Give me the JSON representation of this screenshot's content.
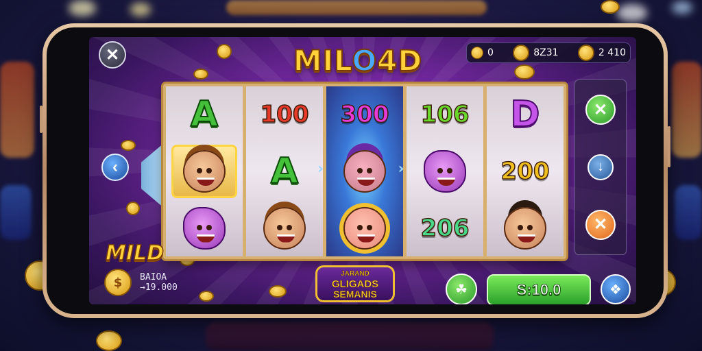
{
  "app": {
    "logo_prefix": "MIL",
    "logo_o": "O",
    "logo_suffix": "4D"
  },
  "topbar": {
    "coins_value": "0",
    "bonus_value": "8Z31",
    "balance_value": "2 410"
  },
  "reels": [
    {
      "symbols": [
        {
          "type": "letter",
          "text": "A",
          "class": "letterA"
        },
        {
          "type": "face",
          "style": "hair",
          "highlight": true
        },
        {
          "type": "face",
          "style": "blob"
        }
      ]
    },
    {
      "symbols": [
        {
          "type": "number",
          "text": "100",
          "color": "#e83a2a"
        },
        {
          "type": "letter",
          "text": "A",
          "class": "letterA"
        },
        {
          "type": "face",
          "style": "hair"
        }
      ]
    },
    {
      "glow": true,
      "symbols": [
        {
          "type": "number",
          "text": "300",
          "color": "#e83ad8"
        },
        {
          "type": "face",
          "style": "purple"
        },
        {
          "type": "face",
          "style": "gold"
        }
      ]
    },
    {
      "symbols": [
        {
          "type": "number",
          "text": "106",
          "color": "#6ad82a"
        },
        {
          "type": "face",
          "style": "blob"
        },
        {
          "type": "number",
          "text": "206",
          "color": "#4ad88a"
        }
      ]
    },
    {
      "symbols": [
        {
          "type": "letter",
          "text": "D",
          "class": "letterD"
        },
        {
          "type": "number",
          "text": "200",
          "color": "#f0c020"
        },
        {
          "type": "face",
          "style": "hat"
        }
      ]
    }
  ],
  "left": {
    "mild_label": "MILD",
    "coin_symbol": "$",
    "balance_line1": "BAIOA",
    "balance_line2": "→19.000"
  },
  "game_badge": {
    "line1": "JARAND",
    "line2": "GLIGADS",
    "line3": "SEMANIS"
  },
  "controls": {
    "spin_label": "S:10.0",
    "close_icon": "✕",
    "back_icon": "‹",
    "check_icon": "✕",
    "down_icon": "↓",
    "cancel_icon": "✕",
    "leaf_icon": "☘",
    "puzzle_icon": "❖"
  },
  "colors": {
    "accent_gold": "#ffd23a",
    "spin_green": "#2aa02a",
    "screen_purple": "#7a2aa6"
  }
}
